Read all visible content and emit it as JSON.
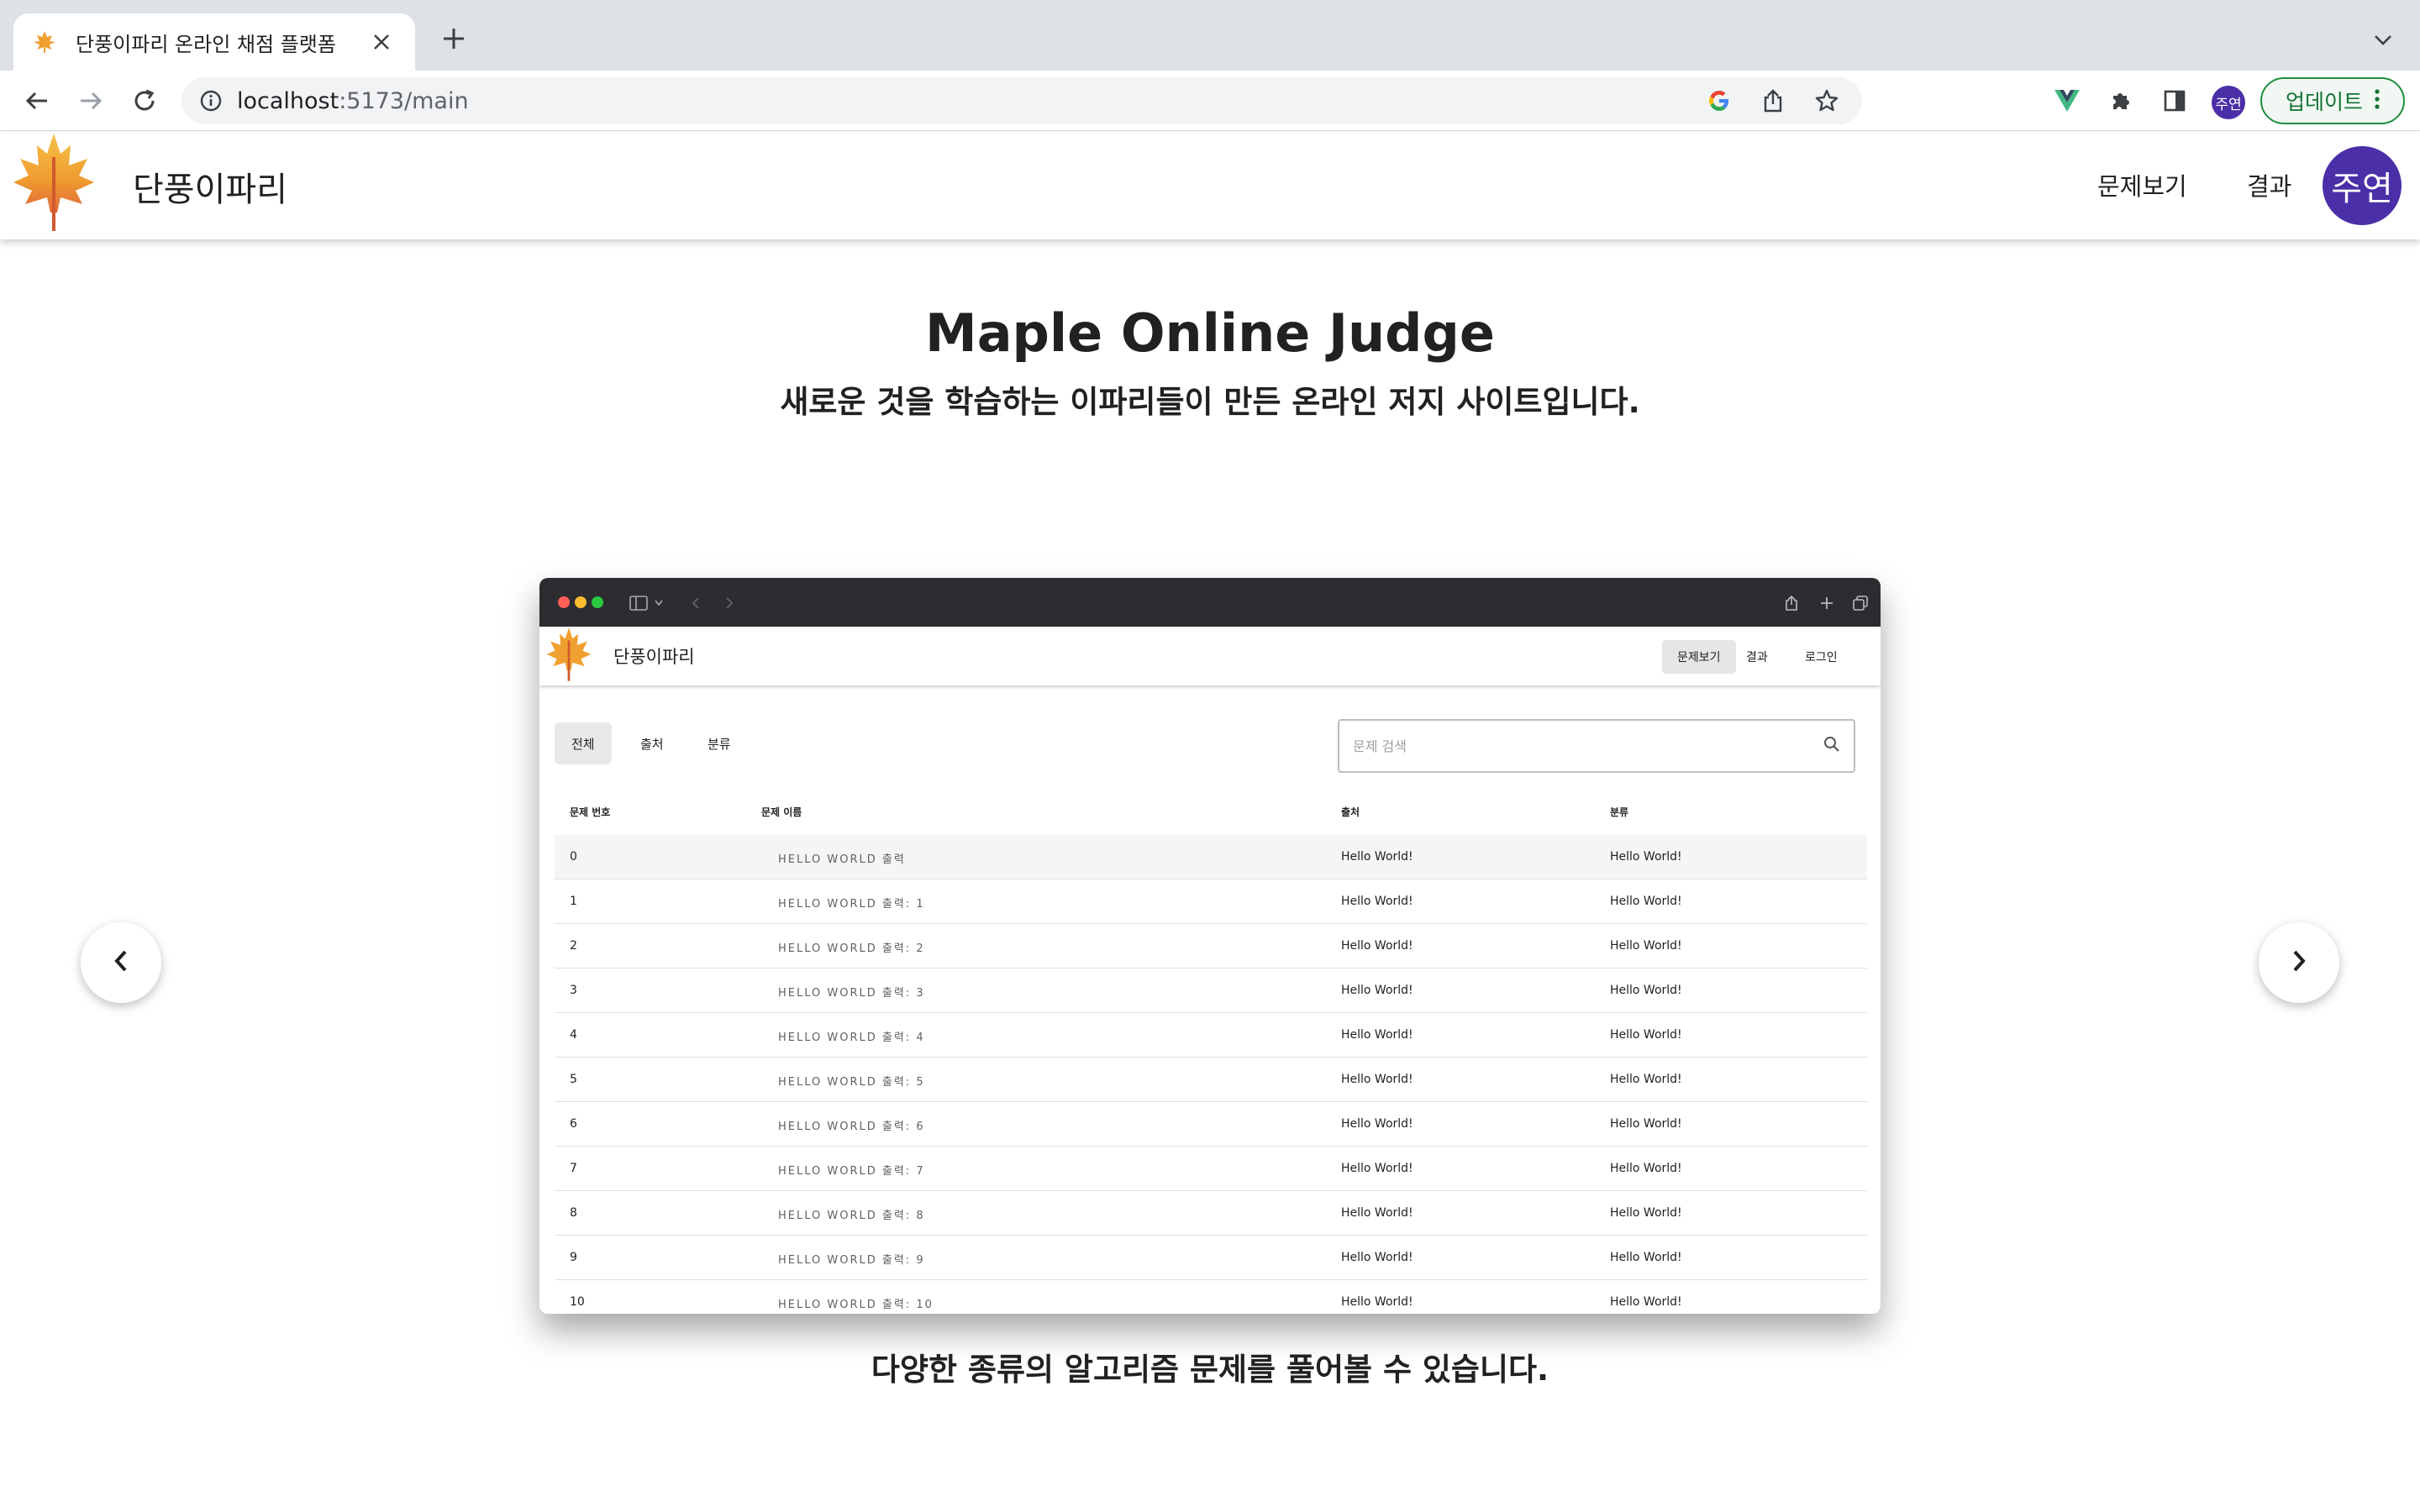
{
  "browser": {
    "tab_title": "단풍이파리 온라인 채점 플랫폼",
    "url_host": "localhost",
    "url_path": ":5173/main",
    "profile_initials": "주연",
    "update_label": "업데이트"
  },
  "site": {
    "name": "단풍이파리",
    "nav": {
      "problems": "문제보기",
      "results": "결과"
    },
    "avatar": "주연"
  },
  "hero": {
    "title": "Maple Online Judge",
    "subtitle": "새로운 것을 학습하는 이파리들이 만든 온라인 저지 사이트입니다."
  },
  "preview": {
    "site_name": "단풍이파리",
    "nav": {
      "problems": "문제보기",
      "results": "결과",
      "login": "로그인"
    },
    "filters": [
      "전체",
      "출처",
      "분류"
    ],
    "search_placeholder": "문제 검색",
    "columns": [
      "문제 번호",
      "문제 이름",
      "출처",
      "분류"
    ],
    "rows": [
      {
        "id": "0",
        "title": "HELLO WORLD 출력",
        "source": "Hello World!",
        "category": "Hello World!"
      },
      {
        "id": "1",
        "title": "HELLO WORLD 출력: 1",
        "source": "Hello World!",
        "category": "Hello World!"
      },
      {
        "id": "2",
        "title": "HELLO WORLD 출력: 2",
        "source": "Hello World!",
        "category": "Hello World!"
      },
      {
        "id": "3",
        "title": "HELLO WORLD 출력: 3",
        "source": "Hello World!",
        "category": "Hello World!"
      },
      {
        "id": "4",
        "title": "HELLO WORLD 출력: 4",
        "source": "Hello World!",
        "category": "Hello World!"
      },
      {
        "id": "5",
        "title": "HELLO WORLD 출력: 5",
        "source": "Hello World!",
        "category": "Hello World!"
      },
      {
        "id": "6",
        "title": "HELLO WORLD 출력: 6",
        "source": "Hello World!",
        "category": "Hello World!"
      },
      {
        "id": "7",
        "title": "HELLO WORLD 출력: 7",
        "source": "Hello World!",
        "category": "Hello World!"
      },
      {
        "id": "8",
        "title": "HELLO WORLD 출력: 8",
        "source": "Hello World!",
        "category": "Hello World!"
      },
      {
        "id": "9",
        "title": "HELLO WORLD 출력: 9",
        "source": "Hello World!",
        "category": "Hello World!"
      },
      {
        "id": "10",
        "title": "HELLO WORLD 출력: 10",
        "source": "Hello World!",
        "category": "Hello World!"
      }
    ]
  },
  "caption": "다양한 종류의 알고리즘 문제를 풀어볼 수 있습니다.",
  "icons": {
    "favicon": "maple-leaf-icon",
    "back": "arrow-left-icon",
    "forward": "arrow-right-icon",
    "reload": "reload-icon",
    "carousel_prev": "chevron-left-icon",
    "carousel_next": "chevron-right-icon"
  },
  "colors": {
    "avatar": "#4a2fa8",
    "update_border": "#1e8e3e",
    "preview_titlebar": "#2d2c31"
  }
}
